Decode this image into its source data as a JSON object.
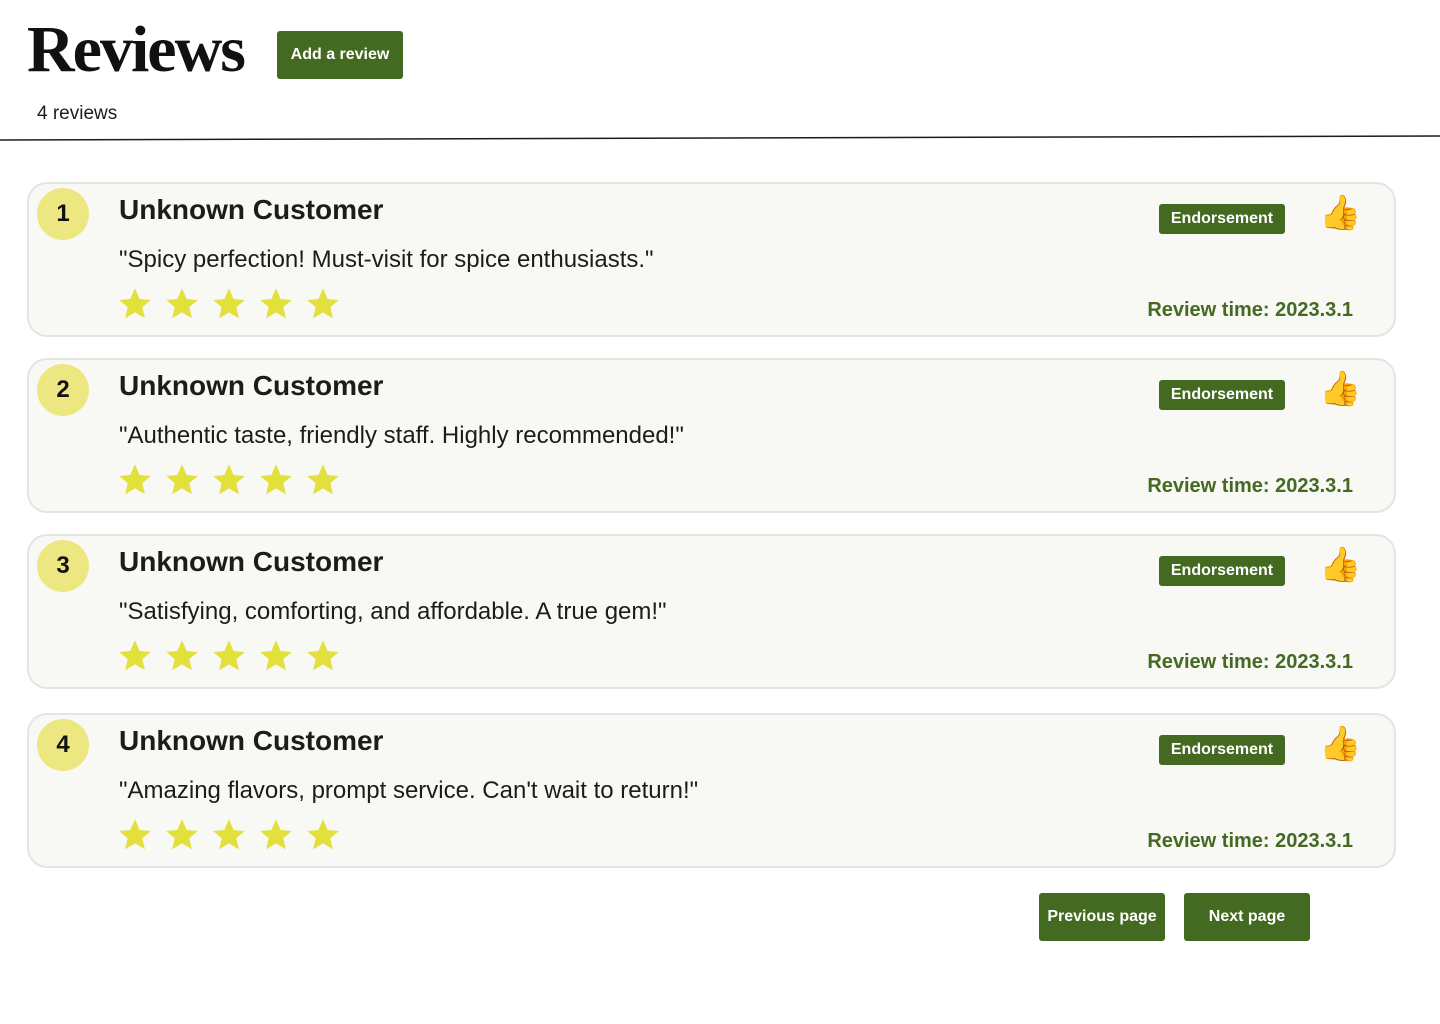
{
  "header": {
    "title": "Reviews",
    "add_button_label": "Add a review",
    "count_text": "4 reviews"
  },
  "reviews": [
    {
      "number": "1",
      "name": "Unknown Customer",
      "text": "\"Spicy perfection! Must-visit for spice enthusiasts.\"",
      "rating": 5,
      "badge": "Endorsement",
      "time": "Review time: 2023.3.1"
    },
    {
      "number": "2",
      "name": "Unknown Customer",
      "text": "\"Authentic taste, friendly staff. Highly recommended!\"",
      "rating": 5,
      "badge": "Endorsement",
      "time": "Review time: 2023.3.1"
    },
    {
      "number": "3",
      "name": "Unknown Customer",
      "text": "\"Satisfying, comforting, and affordable. A true gem!\"",
      "rating": 5,
      "badge": "Endorsement",
      "time": "Review time: 2023.3.1"
    },
    {
      "number": "4",
      "name": "Unknown Customer",
      "text": "\"Amazing flavors, prompt service. Can't wait to return!\"",
      "rating": 5,
      "badge": "Endorsement",
      "time": "Review time: 2023.3.1"
    }
  ],
  "pagination": {
    "previous_label": "Previous page",
    "next_label": "Next page"
  },
  "icons": {
    "star": "star-icon",
    "thumb": "thumbs-up-icon"
  },
  "colors": {
    "accent": "#436a20",
    "star": "#e3df3c",
    "badge_circle": "#ece780",
    "card_bg": "#f8f8f4"
  }
}
